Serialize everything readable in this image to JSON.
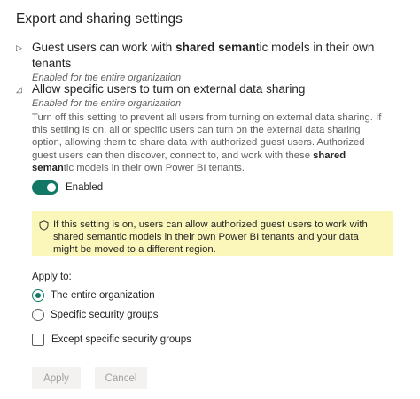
{
  "header": {
    "title": "Export and sharing settings"
  },
  "sections": [
    {
      "title_pre": "Guest users can work with ",
      "title_bold": "shared seman",
      "title_post": "tic models in their own tenants",
      "subtitle": "Enabled for the entire organization",
      "expanded": false
    },
    {
      "title": "Allow specific users to turn on external data sharing",
      "subtitle": "Enabled for the entire organization",
      "expanded": true,
      "description_pre": "Turn off this setting to prevent all users from turning on external data sharing. If this setting is on, all or specific users can turn on the external data sharing option, allowing them to share data with authorized guest users. Authorized guest users can then discover, connect to, and work with these ",
      "description_bold": "shared seman",
      "description_post": "tic models in their own Power BI tenants.",
      "toggle_label": "Enabled",
      "toggle_on": true,
      "warning": "If this setting is on, users can allow authorized guest users to work with shared semantic models in their own Power BI tenants and your data might be moved to a different region.",
      "apply_to_label": "Apply to:",
      "radio_options": [
        {
          "label": "The entire organization",
          "selected": true
        },
        {
          "label": "Specific security groups",
          "selected": false
        }
      ],
      "except_label": "Except specific security groups",
      "except_checked": false
    }
  ],
  "buttons": {
    "apply": "Apply",
    "cancel": "Cancel"
  },
  "colors": {
    "accent": "#117865",
    "warning_bg": "#fbf6b9",
    "disabled_bg": "#f3f2f1",
    "disabled_text": "#a19f9d"
  },
  "icons": {
    "collapsed": "caret-right-icon",
    "expanded": "caret-down-icon",
    "warning": "shield-icon"
  }
}
